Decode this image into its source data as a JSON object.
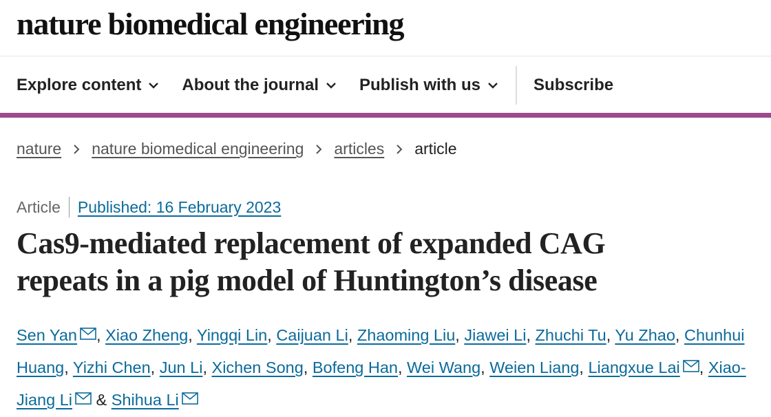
{
  "header": {
    "brand": "nature biomedical engineering"
  },
  "nav": {
    "items": [
      {
        "label": "Explore content",
        "icon": "chevron-down-icon"
      },
      {
        "label": "About the journal",
        "icon": "chevron-down-icon"
      },
      {
        "label": "Publish with us",
        "icon": "chevron-down-icon"
      }
    ],
    "subscribe": "Subscribe"
  },
  "accent_color": "#9b4a8c",
  "link_color": "#0b6a9b",
  "breadcrumb": [
    "nature",
    "nature biomedical engineering",
    "articles",
    "article"
  ],
  "article": {
    "type": "Article",
    "published": "Published: 16 February 2023",
    "title_line1": "Cas9-mediated replacement of expanded CAG",
    "title_line2": "repeats in a pig model of Huntington’s disease",
    "authors": [
      "Sen Yan",
      "Xiao Zheng",
      "Yingqi Lin",
      "Caijuan Li",
      "Zhaoming Liu",
      "Jiawei Li",
      "Zhuchi Tu",
      "Yu Zhao",
      "Chunhui Huang",
      "Yizhi Chen",
      "Jun Li",
      "Xichen Song",
      "Bofeng Han",
      "Wei Wang",
      "Weien Liang",
      "Liangxue Lai",
      "Xiao-Jiang Li",
      "Shihua Li"
    ],
    "authors_and": "&"
  }
}
